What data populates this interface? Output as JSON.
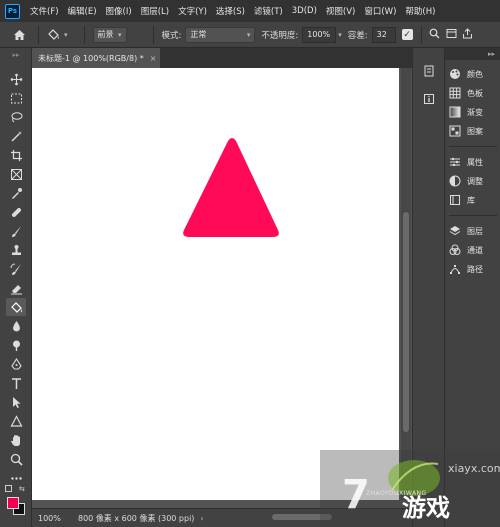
{
  "app": {
    "logo": "Ps"
  },
  "menu": [
    "文件(F)",
    "编辑(E)",
    "图像(I)",
    "图层(L)",
    "文字(Y)",
    "选择(S)",
    "滤镜(T)",
    "3D(D)",
    "视图(V)",
    "窗口(W)",
    "帮助(H)"
  ],
  "options": {
    "fill_source": "前景",
    "mode_label": "模式:",
    "mode_value": "正常",
    "opacity_label": "不透明度:",
    "opacity_value": "100%",
    "tolerance_label": "容差:",
    "tolerance_value": "32",
    "antialias_checked": "✓"
  },
  "document": {
    "tab_title": "未标题-1 @ 100%(RGB/8) *",
    "tab_close": "×"
  },
  "canvas": {
    "shape": "triangle",
    "shape_color": "#ff0a57",
    "background": "#ffffff"
  },
  "status": {
    "zoom": "100%",
    "info": "800 像素 x 600 像素 (300 ppi)"
  },
  "colors": {
    "foreground": "#f0004f",
    "background": "#111111",
    "ui_dark": "#323232",
    "ui_panel": "#424242",
    "ui_workspace": "#535353"
  },
  "panels": [
    {
      "label": "颜色",
      "icon": "palette-icon"
    },
    {
      "label": "色板",
      "icon": "swatches-icon"
    },
    {
      "label": "渐变",
      "icon": "gradient-icon"
    },
    {
      "label": "图案",
      "icon": "pattern-icon"
    },
    {
      "label": "属性",
      "icon": "properties-icon"
    },
    {
      "label": "调整",
      "icon": "adjustments-icon"
    },
    {
      "label": "库",
      "icon": "libraries-icon"
    },
    {
      "label": "图层",
      "icon": "layers-icon"
    },
    {
      "label": "通道",
      "icon": "channels-icon"
    },
    {
      "label": "路径",
      "icon": "paths-icon"
    }
  ],
  "watermark": {
    "site": "xiayx.com",
    "digit": "7",
    "brand": "游戏",
    "pinyin": "ZHAOYOUXIWANG"
  }
}
